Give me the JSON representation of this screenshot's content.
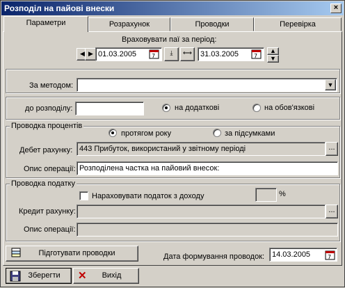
{
  "window": {
    "title": "Розподіл на пайові внески",
    "close_glyph": "×"
  },
  "tabs": [
    {
      "label": "Параметри"
    },
    {
      "label": "Розрахунок"
    },
    {
      "label": "Проводки"
    },
    {
      "label": "Перевірка"
    }
  ],
  "period": {
    "label": "Враховувати паї за період:",
    "from": "01.03.2005",
    "to": "31.03.2005"
  },
  "method": {
    "label": "За методом:",
    "value": ""
  },
  "distribution": {
    "label": "до розподілу:",
    "value": "",
    "option_additional": "на додаткові",
    "option_mandatory": "на обов'язкові",
    "selected": "additional"
  },
  "interest_posting": {
    "title": "Проводка процентів",
    "option_during_year": "протягом року",
    "option_totals": "за підсумками",
    "selected": "during_year",
    "debit_label": "Дебет рахунку:",
    "debit_value": "443 Прибуток, використаний у звітному періоді",
    "description_label": "Опис операції:",
    "description_value": "Розподілена частка на пайовий внесок:"
  },
  "tax_posting": {
    "title": "Проводка податку",
    "accrue_label": "Нараховувати податок з доходу",
    "accrue_checked": false,
    "percent_value": "",
    "percent_sign": "%",
    "credit_label": "Кредит рахунку:",
    "credit_value": "",
    "description_label": "Опис операції:",
    "description_value": ""
  },
  "prepare_button": {
    "label": "Підготувати проводки"
  },
  "posting_date": {
    "label": "Дата формування проводок:",
    "value": "14.03.2005"
  },
  "footer": {
    "save_label": "Зберегти",
    "exit_label": "Вихід"
  },
  "ellipsis": "..."
}
